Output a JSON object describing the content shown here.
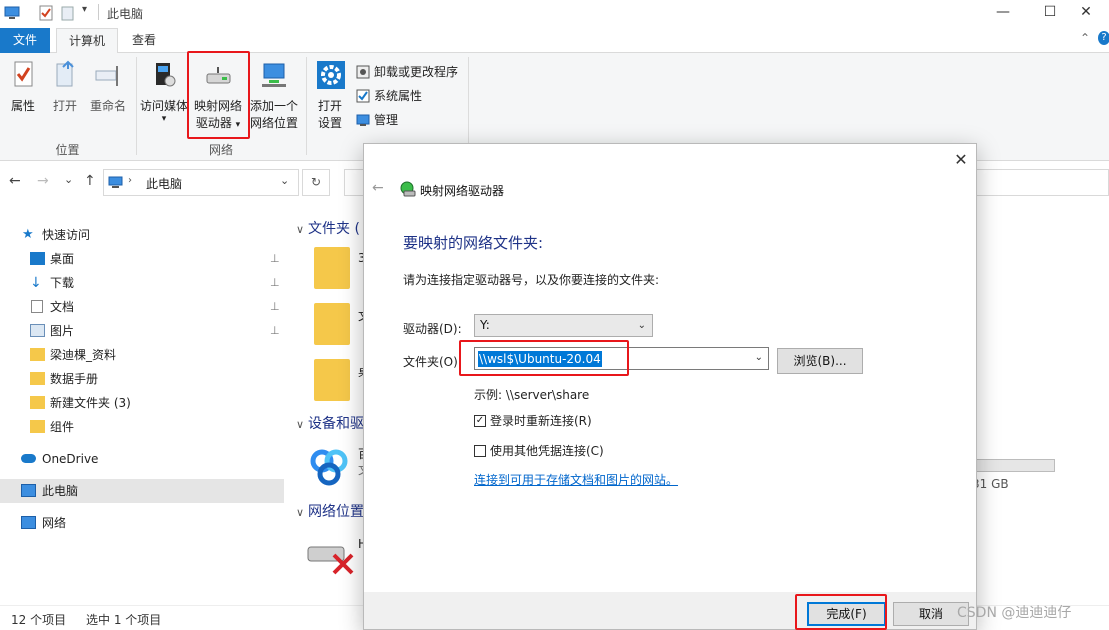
{
  "window": {
    "title": "此电脑",
    "minimize": "—",
    "maximize": "☐",
    "close": "✕",
    "collapse": "⌃",
    "help": "?"
  },
  "tabs": [
    "文件",
    "计算机",
    "查看"
  ],
  "ribbon": {
    "location": {
      "label": "位置",
      "buttons": [
        "属性",
        "打开",
        "重命名"
      ]
    },
    "network": {
      "label": "网络",
      "buttons": [
        "访问媒体",
        "映射网络",
        "驱动器",
        "添加一个",
        "网络位置"
      ]
    },
    "system": {
      "buttons": [
        "打开",
        "设置"
      ],
      "items": [
        "卸载或更改程序",
        "系统属性",
        "管理"
      ]
    }
  },
  "address": {
    "path": "此电脑",
    "back": "←",
    "forward": "→",
    "recent": "⌄",
    "up": "↑",
    "dropdown": "⌄",
    "refresh": "↻"
  },
  "nav_pane": {
    "quick_access": "快速访问",
    "items": [
      "桌面",
      "下载",
      "文档",
      "图片",
      "梁迪棵_资料",
      "数据手册",
      "新建文件夹 (3)",
      "组件"
    ],
    "onedrive": "OneDrive",
    "this_pc": "此电脑",
    "network": "网络",
    "pin": "📌"
  },
  "content": {
    "sections": [
      "文件夹 (",
      "设备和驱",
      "网络位置"
    ],
    "fragments": [
      "3",
      "文",
      "桌",
      "百",
      "文",
      "H"
    ],
    "size_fragment": "31 GB"
  },
  "status": {
    "count": "12 个项目",
    "selected": "选中 1 个项目"
  },
  "dialog": {
    "title": "映射网络驱动器",
    "close": "✕",
    "back": "←",
    "heading": "要映射的网络文件夹:",
    "description": "请为连接指定驱动器号，以及你要连接的文件夹:",
    "drive_label": "驱动器(D):",
    "drive_value": "Y:",
    "folder_label": "文件夹(O):",
    "folder_value": "\\\\wsl$\\Ubuntu-20.04",
    "browse": "浏览(B)...",
    "example": "示例: \\\\server\\share",
    "reconnect": "登录时重新连接(R)",
    "reconnect_checked": "✓",
    "other_credentials": "使用其他凭据连接(C)",
    "link": "连接到可用于存储文档和图片的网站。",
    "finish": "完成(F)",
    "cancel": "取消"
  },
  "watermark": "CSDN @迪迪迪仔",
  "colors": {
    "accent": "#1979ca",
    "highlight_red": "#e8171b",
    "heading_blue": "#1e3287",
    "link_blue": "#0066cc"
  }
}
